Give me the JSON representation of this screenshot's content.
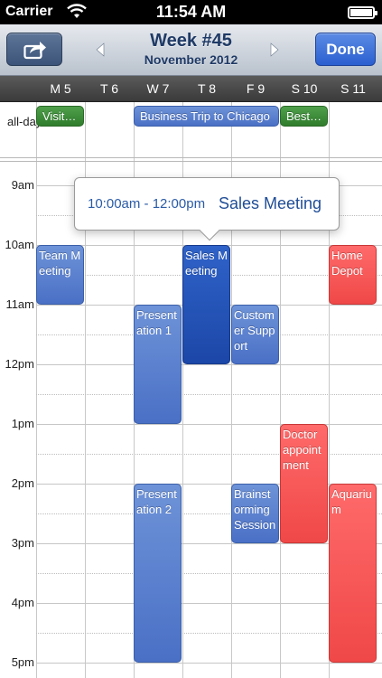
{
  "status_bar": {
    "carrier": "Carrier",
    "time": "11:54 AM"
  },
  "nav": {
    "title": "Week #45",
    "subtitle": "November 2012",
    "done_label": "Done",
    "share_icon": "share-icon",
    "prev_icon": "left-arrow-icon",
    "next_icon": "right-arrow-icon"
  },
  "days": [
    "M 5",
    "T 6",
    "W 7",
    "T 8",
    "F 9",
    "S 10",
    "S 11"
  ],
  "allday_label": "all-day",
  "hours": [
    "9am",
    "10am",
    "11am",
    "12pm",
    "1pm",
    "2pm",
    "3pm",
    "4pm",
    "5pm"
  ],
  "allday_events": [
    {
      "title": "Visit…",
      "color": "green"
    },
    {
      "title": "Business Trip to Chicago",
      "color": "blue"
    },
    {
      "title": "Best…",
      "color": "green"
    }
  ],
  "events": [
    {
      "title": "Team Meeting",
      "day": "M 5",
      "color": "blue"
    },
    {
      "title": "Sales Meeting",
      "day": "T 8",
      "color": "darkblue"
    },
    {
      "title": "Home Depot",
      "day": "S 11",
      "color": "red"
    },
    {
      "title": "Presentation 1",
      "day": "W 7",
      "color": "blue"
    },
    {
      "title": "Customer Support",
      "day": "F 9",
      "color": "blue"
    },
    {
      "title": "Doctor appointment",
      "day": "S 10",
      "color": "red"
    },
    {
      "title": "Presentation 2",
      "day": "W 7",
      "color": "blue"
    },
    {
      "title": "Brainstorming Session",
      "day": "F 9",
      "color": "blue"
    },
    {
      "title": "Aquarium",
      "day": "S 11",
      "color": "red"
    }
  ],
  "popover": {
    "time": "10:00am - 12:00pm",
    "title": "Sales Meeting"
  },
  "colors": {
    "blue": "#4a70c6",
    "darkblue": "#1c47a8",
    "red": "#f04848",
    "green": "#2f7d2c"
  }
}
